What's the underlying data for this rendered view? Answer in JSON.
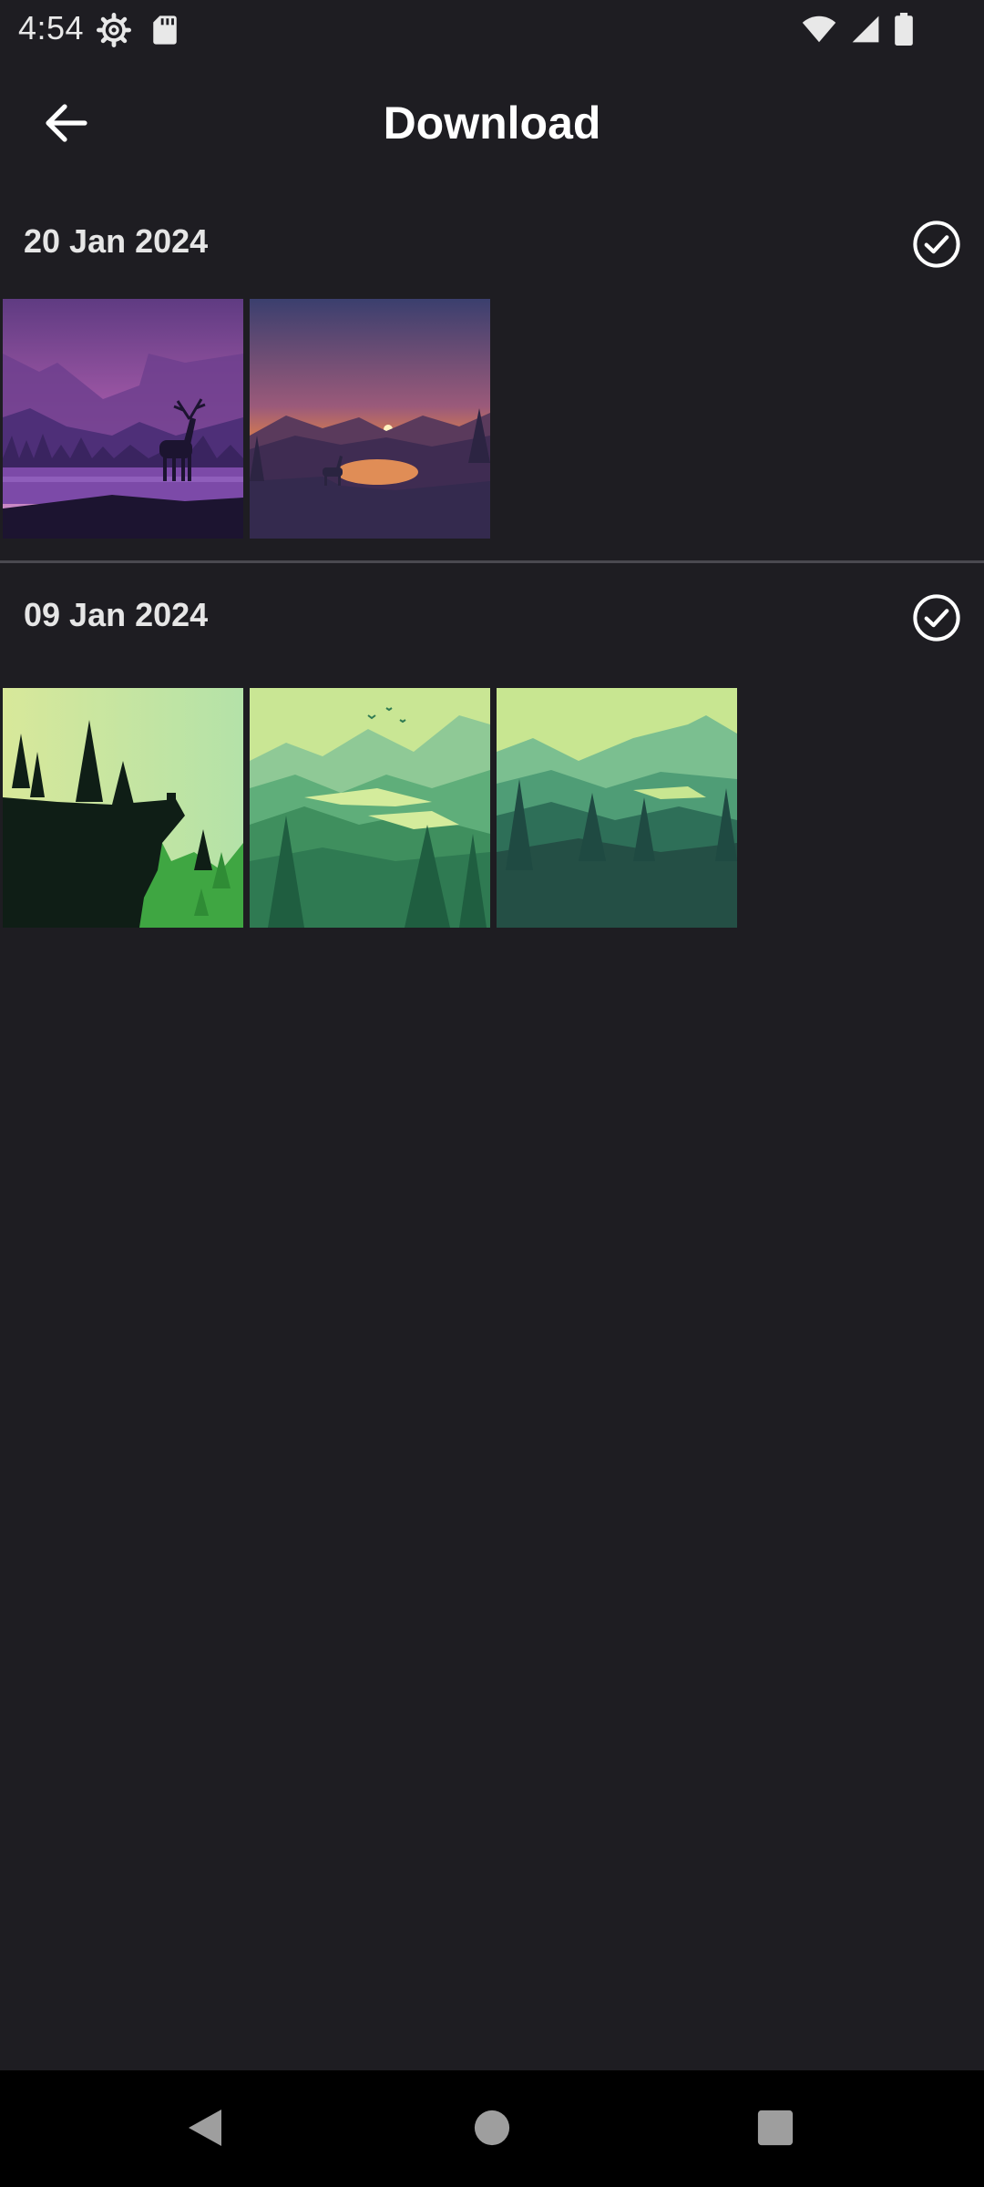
{
  "status_bar": {
    "time": "4:54",
    "left_icons": [
      "settings-gear-icon",
      "sd-card-icon"
    ],
    "right_icons": [
      "wifi-icon",
      "cell-signal-icon",
      "battery-icon"
    ]
  },
  "app_bar": {
    "title": "Download",
    "back_icon": "arrow-left-icon"
  },
  "sections": [
    {
      "date": "20 Jan 2024",
      "select_icon": "check-circle-icon",
      "thumbnails": [
        {
          "subject": "purple-deer-landscape"
        },
        {
          "subject": "sunset-lake-deer"
        }
      ]
    },
    {
      "date": "09 Jan 2024",
      "select_icon": "check-circle-icon",
      "thumbnails": [
        {
          "subject": "green-cliff-trees"
        },
        {
          "subject": "green-forest-river"
        },
        {
          "subject": "green-mountain-forest"
        }
      ]
    }
  ],
  "nav_bar": {
    "buttons": [
      "back-triangle-icon",
      "home-circle-icon",
      "recents-square-icon"
    ]
  },
  "colors": {
    "background": "#1e1d22",
    "nav_background": "#000000",
    "divider": "#4a4950",
    "text": "#ffffff"
  }
}
